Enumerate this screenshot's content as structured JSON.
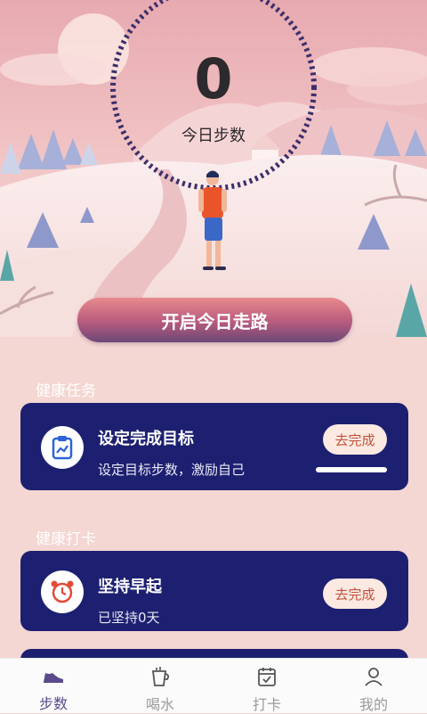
{
  "steps": {
    "count": "0",
    "label": "今日步数",
    "start_button": "开启今日走路"
  },
  "health_tasks": {
    "section_title": "健康任务",
    "items": [
      {
        "title": "设定完成目标",
        "subtitle": "设定目标步数，激励自己",
        "action": "去完成",
        "icon": "chart-clipboard-icon"
      }
    ]
  },
  "health_checkin": {
    "section_title": "健康打卡",
    "items": [
      {
        "title": "坚持早起",
        "subtitle": "已坚持0天",
        "action": "去完成",
        "icon": "alarm-clock-icon"
      }
    ]
  },
  "tabbar": {
    "items": [
      {
        "label": "步数",
        "icon": "shoe-icon",
        "active": true
      },
      {
        "label": "喝水",
        "icon": "cup-icon",
        "active": false
      },
      {
        "label": "打卡",
        "icon": "calendar-check-icon",
        "active": false
      },
      {
        "label": "我的",
        "icon": "user-icon",
        "active": false
      }
    ]
  },
  "colors": {
    "card_bg": "#1d2070",
    "accent": "#5b4a8c",
    "button_text": "#c0533a"
  }
}
